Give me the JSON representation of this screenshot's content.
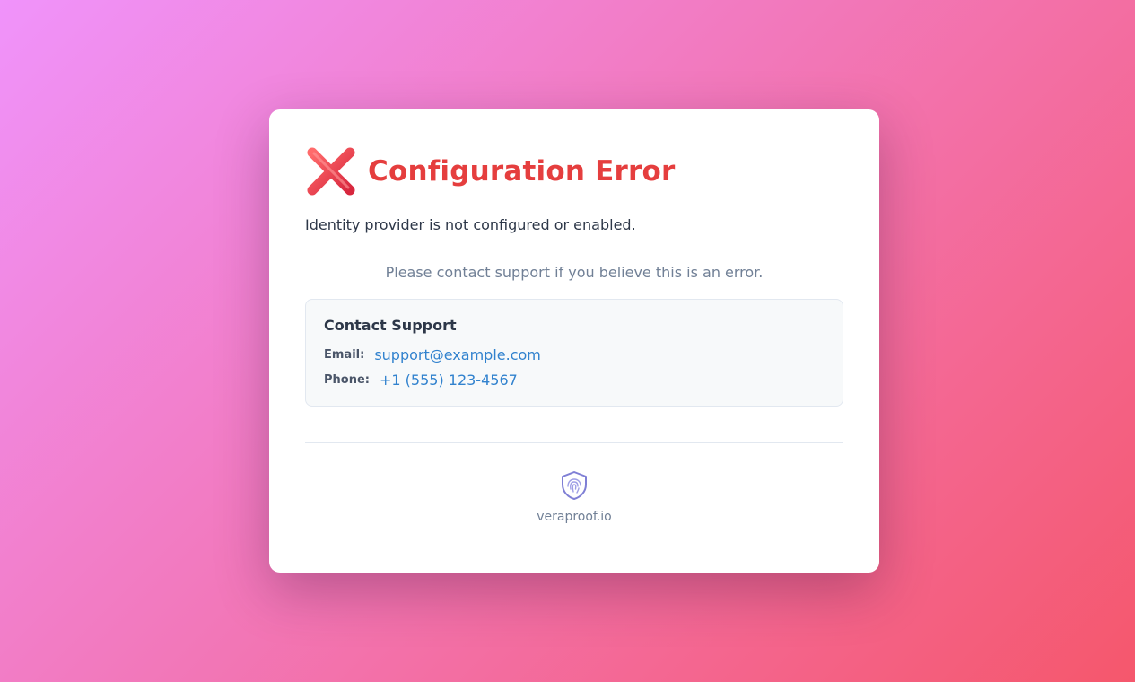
{
  "page": {
    "title": "Configuration Error",
    "title_icon": "cross-mark-icon",
    "error_message": "Identity provider is not configured or enabled.",
    "contact_hint": "Please contact support if you believe this is an error."
  },
  "support": {
    "heading": "Contact Support",
    "email_label": "Email:",
    "email_value": "support@example.com",
    "phone_label": "Phone:",
    "phone_value": "+1 (555) 123-4567"
  },
  "footer": {
    "logo_icon": "shield-fingerprint-icon",
    "brand": "veraproof.io"
  },
  "colors": {
    "background_start": "#f093fb",
    "background_end": "#f5576c",
    "error_red": "#e53e3e",
    "link_blue": "#3182ce",
    "logo_purple": "#7f7fd5"
  }
}
